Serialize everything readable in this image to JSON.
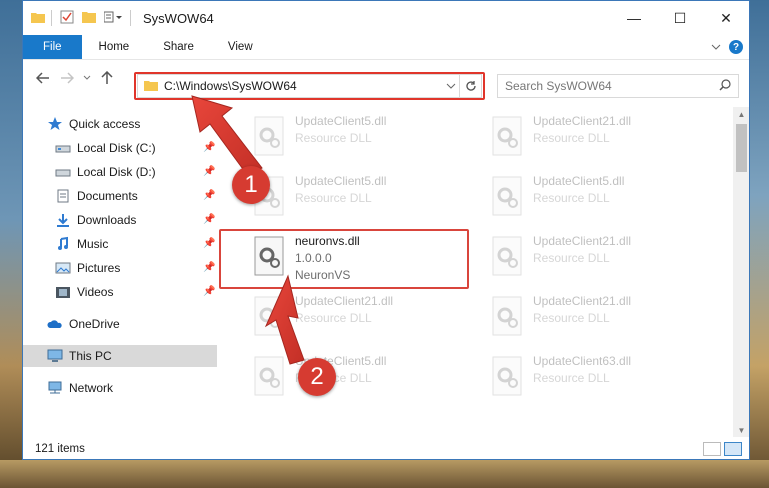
{
  "window": {
    "title": "SysWOW64",
    "controls": {
      "minimize": "—",
      "maximize": "☐",
      "close": "✕"
    }
  },
  "ribbon": {
    "tabs": [
      "File",
      "Home",
      "Share",
      "View"
    ],
    "help": "?"
  },
  "navigation": {
    "address": "C:\\Windows\\SysWOW64",
    "search_placeholder": "Search SysWOW64"
  },
  "sidebar": {
    "items": [
      {
        "label": "Quick access",
        "icon": "star-icon",
        "pinned": false
      },
      {
        "label": "Local Disk (C:)",
        "icon": "drive-icon",
        "pinned": true
      },
      {
        "label": "Local Disk (D:)",
        "icon": "drive-icon",
        "pinned": true
      },
      {
        "label": "Documents",
        "icon": "documents-icon",
        "pinned": true
      },
      {
        "label": "Downloads",
        "icon": "downloads-icon",
        "pinned": true
      },
      {
        "label": "Music",
        "icon": "music-icon",
        "pinned": true
      },
      {
        "label": "Pictures",
        "icon": "pictures-icon",
        "pinned": true
      },
      {
        "label": "Videos",
        "icon": "videos-icon",
        "pinned": true
      },
      {
        "label": "OneDrive",
        "icon": "onedrive-icon",
        "pinned": false
      },
      {
        "label": "This PC",
        "icon": "computer-icon",
        "pinned": false,
        "selected": true
      },
      {
        "label": "Network",
        "icon": "network-icon",
        "pinned": false
      }
    ]
  },
  "files": {
    "left_column": [
      {
        "name": "UpdateClient5.dll",
        "sub": "Resource DLL",
        "faded": true
      },
      {
        "name": "UpdateClient5.dll",
        "sub": "Resource DLL",
        "faded": true
      },
      {
        "name": "neuronvs.dll",
        "version": "1.0.0.0",
        "sub": "NeuronVS",
        "faded": false,
        "highlighted": true
      },
      {
        "name": "UpdateClient21.dll",
        "sub": "Resource DLL",
        "faded": true
      },
      {
        "name": "UpdateClient5.dll",
        "sub": "Resource DLL",
        "faded": true
      }
    ],
    "right_column": [
      {
        "name": "UpdateClient21.dll",
        "sub": "Resource DLL",
        "faded": true
      },
      {
        "name": "UpdateClient5.dll",
        "sub": "Resource DLL",
        "faded": true
      },
      {
        "name": "UpdateClient21.dll",
        "sub": "Resource DLL",
        "faded": true
      },
      {
        "name": "UpdateClient21.dll",
        "sub": "Resource DLL",
        "faded": true
      },
      {
        "name": "UpdateClient63.dll",
        "sub": "Resource DLL",
        "faded": true
      }
    ]
  },
  "status": {
    "item_count": "121 items"
  },
  "callouts": [
    "1",
    "2"
  ],
  "colors": {
    "accent": "#1979ca",
    "callout": "#d63b31"
  }
}
